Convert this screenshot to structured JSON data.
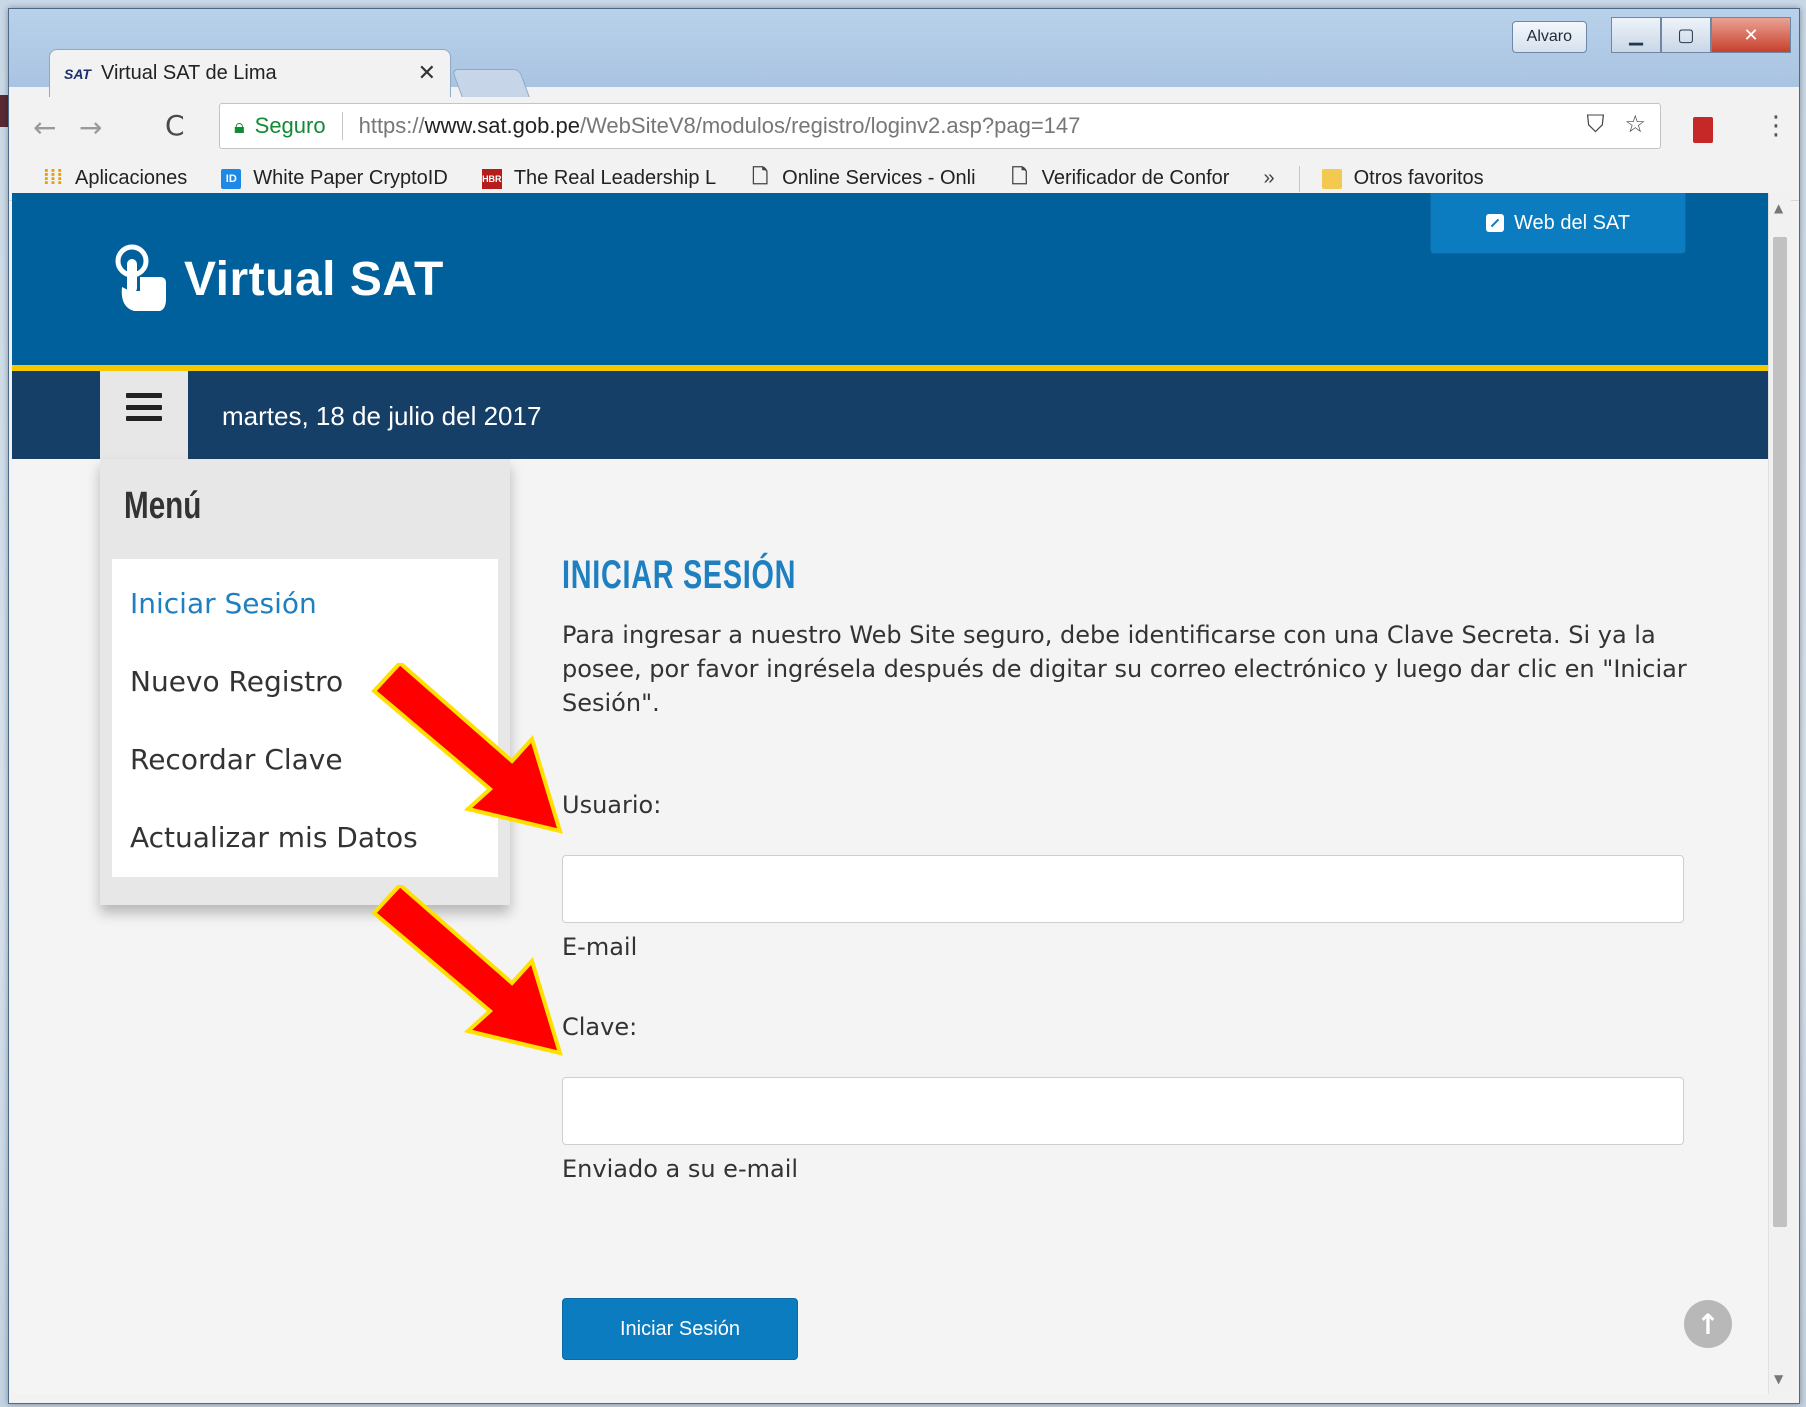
{
  "browser": {
    "profile_name": "Alvaro",
    "tab_title": "Virtual SAT de Lima",
    "tab_favicon_text": "SAT",
    "secure_label": "Seguro",
    "url_scheme": "https://",
    "url_host": "www.sat.gob.pe",
    "url_path": "/WebSiteV8/modulos/registro/loginv2.asp?pag=147",
    "bookmarks": [
      {
        "label": "Aplicaciones",
        "icon": "apps-grid-icon"
      },
      {
        "label": "White Paper CryptoID",
        "icon": "id-icon",
        "icon_text": "ID"
      },
      {
        "label": "The Real Leadership L",
        "icon": "hbr-icon",
        "icon_text": "HBR"
      },
      {
        "label": "Online Services - Onli",
        "icon": "page-icon"
      },
      {
        "label": "Verificador de Confor",
        "icon": "page-icon"
      }
    ],
    "bookmarks_more": "»",
    "other_bookmarks": "Otros favoritos"
  },
  "site": {
    "title": "Virtual SAT",
    "web_link_label": "Web del SAT",
    "date": "martes, 18 de julio del 2017"
  },
  "menu": {
    "heading": "Menú",
    "items": [
      {
        "label": "Iniciar Sesión",
        "active": true
      },
      {
        "label": "Nuevo Registro",
        "active": false
      },
      {
        "label": "Recordar Clave",
        "active": false
      },
      {
        "label": "Actualizar mis Datos",
        "active": false
      }
    ]
  },
  "login": {
    "title": "INICIAR SESIÓN",
    "intro": "Para ingresar a nuestro Web Site seguro, debe identificarse con una Clave Secreta. Si ya la posee, por favor ingrésela después de digitar su correo electrónico y luego dar clic en \"Iniciar Sesión\".",
    "user_label": "Usuario:",
    "user_value": "",
    "user_hint": "E-mail",
    "password_label": "Clave:",
    "password_value": "",
    "password_hint": "Enviado a su e-mail",
    "submit_label": "Iniciar Sesión"
  },
  "colors": {
    "brand_blue": "#00609c",
    "subbar_navy": "#163f67",
    "accent_yellow": "#f5c800",
    "link_blue": "#1e7fc1",
    "annotation_arrow": "#ff0000"
  }
}
